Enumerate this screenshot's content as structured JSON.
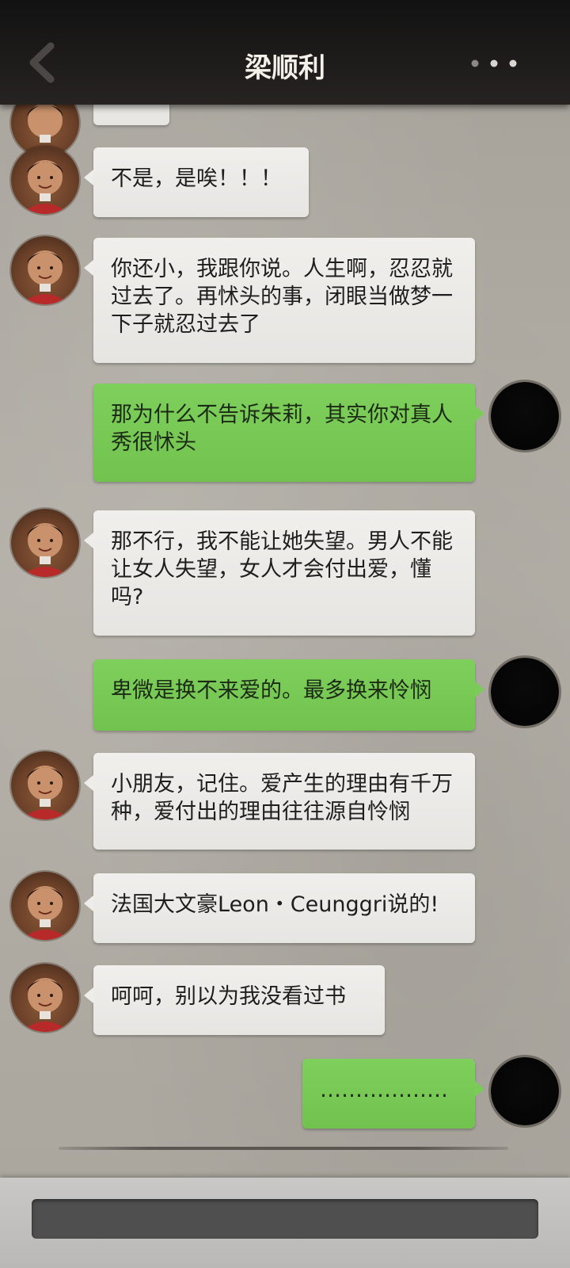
{
  "header": {
    "title": "梁顺利"
  },
  "messages": [
    {
      "side": "left",
      "text": ""
    },
    {
      "side": "left",
      "text": "不是，是唉！！！"
    },
    {
      "side": "left",
      "text": "你还小，我跟你说。人生啊，忍忍就过去了。再怵头的事，闭眼当做梦一下子就忍过去了"
    },
    {
      "side": "right",
      "text": "那为什么不告诉朱莉，其实你对真人秀很怵头"
    },
    {
      "side": "left",
      "text": "那不行，我不能让她失望。男人不能让女人失望，女人才会付出爱，懂吗?"
    },
    {
      "side": "right",
      "text": "卑微是换不来爱的。最多换来怜悯"
    },
    {
      "side": "left",
      "text": "小朋友，记住。爱产生的理由有千万种，爱付出的理由往往源自怜悯"
    },
    {
      "side": "left",
      "text": "法国大文豪Leon・Ceunggri说的!"
    },
    {
      "side": "left",
      "text": "呵呵，别以为我没看过书"
    },
    {
      "side": "right",
      "text": "………………"
    }
  ],
  "input": {
    "value": ""
  }
}
